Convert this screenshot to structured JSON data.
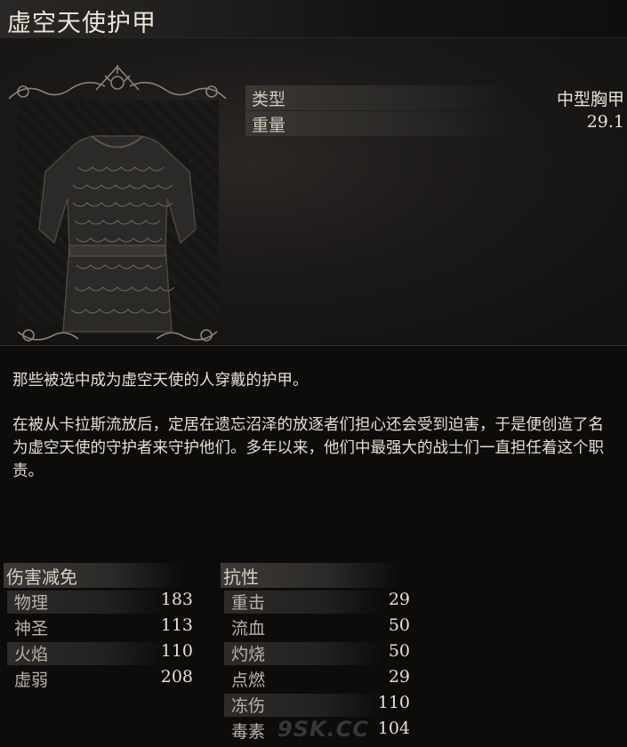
{
  "item": {
    "name": "虚空天使护甲"
  },
  "stats": [
    {
      "label": "类型",
      "value": "中型胸甲"
    },
    {
      "label": "重量",
      "value": "29.1"
    }
  ],
  "description": [
    "那些被选中成为虚空天使的人穿戴的护甲。",
    "在被从卡拉斯流放后，定居在遗忘沼泽的放逐者们担心还会受到迫害，于是便创造了名为虚空天使的守护者来守护他们。多年以来，他们中最强大的战士们一直担任着这个职责。"
  ],
  "damage_reduction": {
    "header": "伤害减免",
    "rows": [
      {
        "label": "物理",
        "value": "183"
      },
      {
        "label": "神圣",
        "value": "113"
      },
      {
        "label": "火焰",
        "value": "110"
      },
      {
        "label": "虚弱",
        "value": "208"
      }
    ]
  },
  "resistance": {
    "header": "抗性",
    "rows": [
      {
        "label": "重击",
        "value": "29"
      },
      {
        "label": "流血",
        "value": "50"
      },
      {
        "label": "灼烧",
        "value": "50"
      },
      {
        "label": "点燃",
        "value": "29"
      },
      {
        "label": "冻伤",
        "value": "110"
      },
      {
        "label": "毒素",
        "value": "104"
      }
    ]
  },
  "watermark": "9SK.CC",
  "colors": {
    "background": "#0f0e0d",
    "text": "#e4ded2",
    "label": "#b9b2a6"
  }
}
